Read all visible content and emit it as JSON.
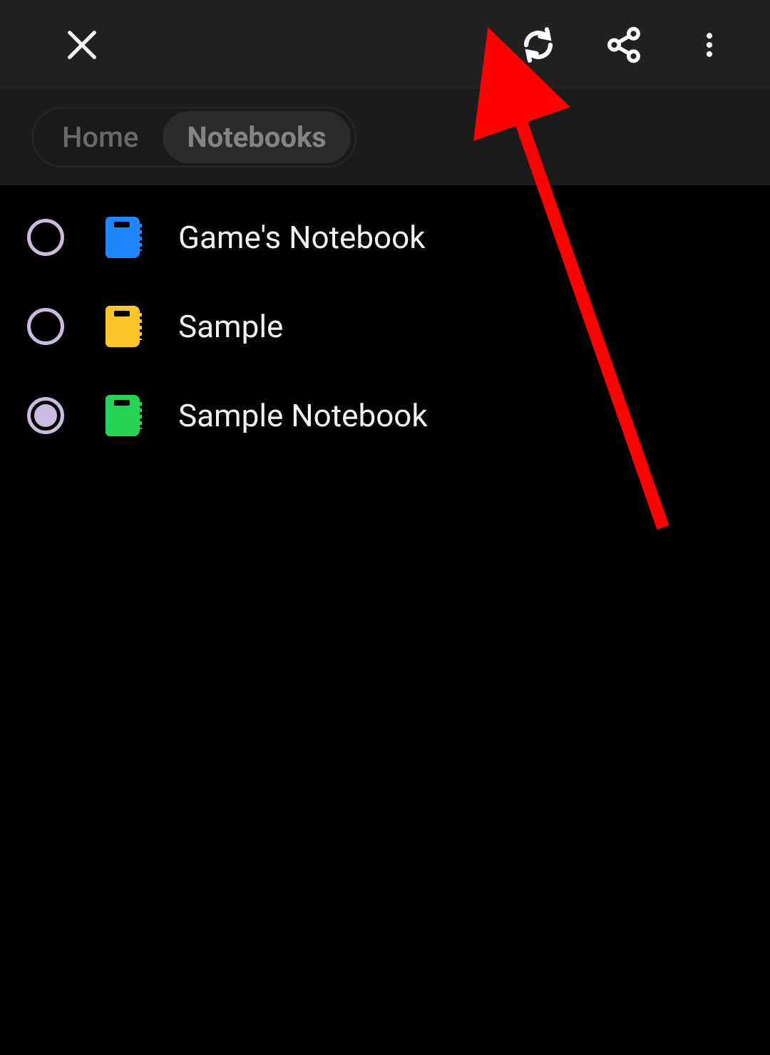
{
  "tabs": {
    "home_label": "Home",
    "notebooks_label": "Notebooks",
    "active": "notebooks"
  },
  "notebooks": [
    {
      "label": "Game's Notebook",
      "color": "#1f87ff",
      "selected": false
    },
    {
      "label": "Sample",
      "color": "#ffc62c",
      "selected": false
    },
    {
      "label": "Sample Notebook",
      "color": "#26d455",
      "selected": true
    }
  ],
  "icons": {
    "close": "close-icon",
    "sync": "sync-icon",
    "share": "share-icon",
    "more": "more-vert-icon"
  }
}
